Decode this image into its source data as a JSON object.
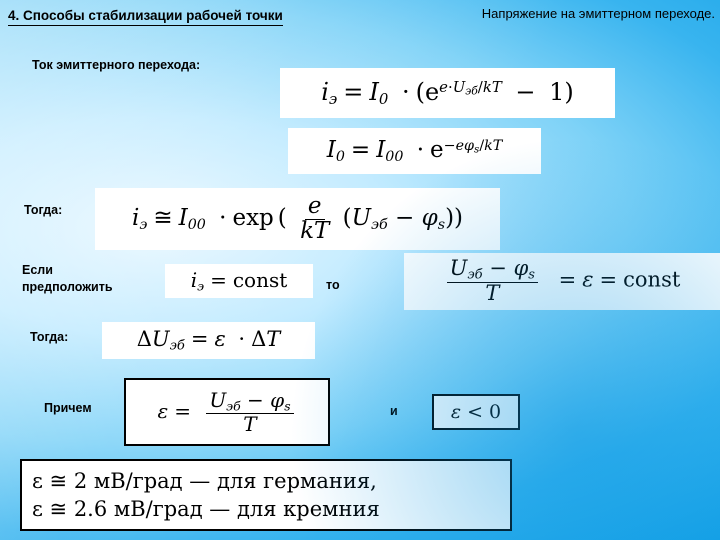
{
  "slide": {
    "title": "4. Способы стабилизации рабочей точки",
    "header_right": "Напряжение на эмиттерном переходе.",
    "labels": {
      "current_of_emitter_junction": "Ток эмиттерного перехода:",
      "then_1": "Тогда:",
      "if_assume": "Если\nпредположить",
      "to": "то",
      "then_2": "Тогда:",
      "moreover": "Причем",
      "and": "и"
    },
    "background_color": "#38b4ef",
    "formula_box_color": "#ffffff",
    "text_color": "#000000"
  },
  "formulas": {
    "f1": {
      "name": "emitter-current-equation",
      "plain": "i_э = I_0 · (e^(e·U_эб/kT) − 1)"
    },
    "f2": {
      "name": "saturation-current-equation",
      "plain": "I_0 = I_00 · e^(−e·φ_s/kT)"
    },
    "f3": {
      "name": "emitter-current-approx-equation",
      "plain": "i_э ≅ I_00 · exp ( e/kT (U_эб − φ_s) )"
    },
    "f4": {
      "name": "constant-current-condition",
      "plain": "i_э = const"
    },
    "f5": {
      "name": "epsilon-definition-equation",
      "plain": "(U_эб − φ_s)/T = ε = const"
    },
    "f6": {
      "name": "delta-voltage-equation",
      "plain": "ΔU_эб = ε · ΔT"
    },
    "f7": {
      "name": "epsilon-formula-boxed",
      "plain": "ε = (U_эб − φ_s)/T"
    },
    "f8": {
      "name": "epsilon-negative-boxed",
      "plain": "ε < 0"
    },
    "f9": {
      "name": "epsilon-values-boxed",
      "line1": "ε ≅ 2 мВ/град — для германия,",
      "line2": "ε ≅ 2.6 мВ/град — для кремния"
    }
  }
}
